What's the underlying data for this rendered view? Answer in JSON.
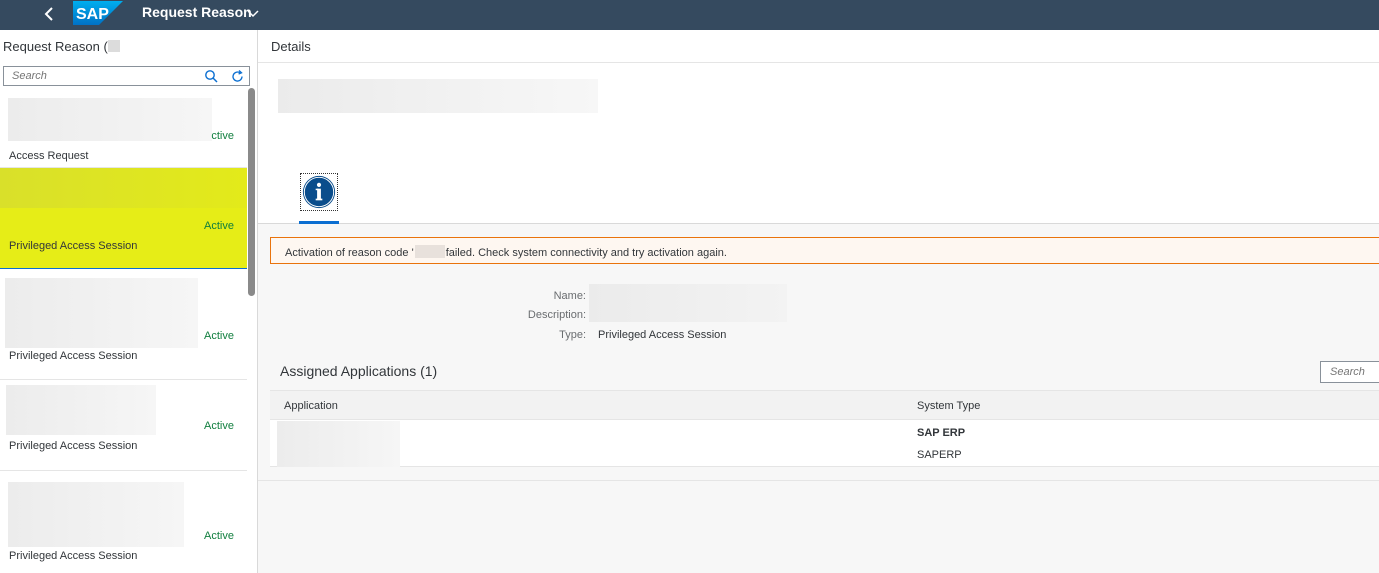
{
  "shell": {
    "title": "Request Reason"
  },
  "master": {
    "header": "Request Reason (",
    "search_placeholder": "Search",
    "items": [
      {
        "status": "ctive",
        "type": "Access Request"
      },
      {
        "status": "Active",
        "type": "Privileged Access Session"
      },
      {
        "status": "Active",
        "type": "Privileged Access Session"
      },
      {
        "status": "Active",
        "type": "Privileged Access Session"
      },
      {
        "status": "Active",
        "type": "Privileged Access Session"
      }
    ]
  },
  "detail": {
    "header": "Details",
    "message": {
      "before": "Activation of reason code '",
      "after": "failed. Check system connectivity and try activation again."
    },
    "form": {
      "name_label": "Name:",
      "description_label": "Description:",
      "type_label": "Type:",
      "type_value": "Privileged Access Session"
    },
    "assigned": {
      "title": "Assigned Applications (1)",
      "search_placeholder": "Search",
      "columns": [
        "Application",
        "System Type"
      ],
      "rows": [
        {
          "system_type": "SAP ERP",
          "system_sub": "SAPERP"
        }
      ]
    }
  },
  "colors": {
    "shell_bg": "#354a5f",
    "active_status": "#107e3e",
    "selected_highlight": "#e6ed17",
    "info_icon": "#0a6ed1",
    "warning_border": "#e9730c"
  }
}
